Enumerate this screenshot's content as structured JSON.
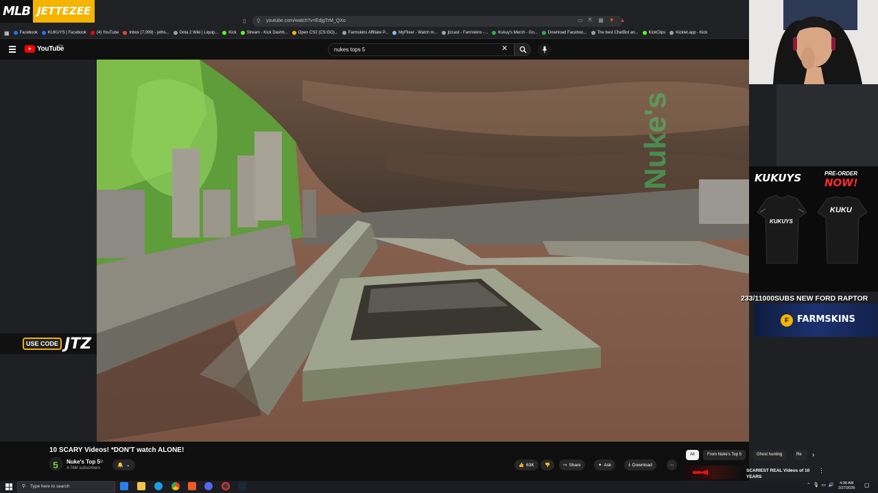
{
  "overlay": {
    "logo_mlb": "MLB",
    "logo_name": "JETTEZEE",
    "use_code_label": "USE CODE",
    "use_code_value": "JTZ",
    "subs_banner": "233/11000SUBS NEW FORD RAPTOR",
    "farmskins_label": "FARMSKINS",
    "merch_brand": "KUKUYS",
    "merch_preorder": "PRE-ORDER",
    "merch_now": "NOW!",
    "jersey_left_text": "KUKUYS",
    "jersey_right_text": "KUKU",
    "nuke_watermark": "Nuke's"
  },
  "browser": {
    "url": "youtube.com/watch?v=EdjgTrM_QXo",
    "bookmarks": [
      {
        "label": "Facebook",
        "color": "#1877f2"
      },
      {
        "label": "KUKUYS | Facebook",
        "color": "#1877f2"
      },
      {
        "label": "(4) YouTube",
        "color": "#ff0000"
      },
      {
        "label": "Inbox (7,099) - jeths...",
        "color": "#ea4335"
      },
      {
        "label": "Dota 2 Wiki | Liquip...",
        "color": "#9aa0a6"
      },
      {
        "label": "Kick",
        "color": "#53fc18"
      },
      {
        "label": "Stream - Kick Dashb...",
        "color": "#53fc18"
      },
      {
        "label": "Open CS2 (CS:GO)...",
        "color": "#f4b400"
      },
      {
        "label": "Farmskins Affiliate P...",
        "color": "#9aa0a6"
      },
      {
        "label": "MyFlixer - Watch m...",
        "color": "#8ab4f8"
      },
      {
        "label": "jtzcast - Farmskins -...",
        "color": "#9aa0a6"
      },
      {
        "label": "Kukuy's Merch - Go...",
        "color": "#34a853"
      },
      {
        "label": "Download Faceboo...",
        "color": "#34a853"
      },
      {
        "label": "The best ChatBot an...",
        "color": "#9aa0a6"
      },
      {
        "label": "KickClips",
        "color": "#53fc18"
      },
      {
        "label": "Kicklet.app - Kick",
        "color": "#9aa0a6"
      }
    ]
  },
  "youtube": {
    "wordmark": "YouTube",
    "country": "PH",
    "search_query": "nukes tops 5",
    "video": {
      "title": "10 SCARY Videos! *DON'T watch ALONE!",
      "channel_name": "Nuke's Top 5",
      "subscribers": "4.76M subscribers",
      "likes": "63K",
      "share_label": "Share",
      "ask_label": "Ask",
      "download_label": "Download"
    },
    "chips": [
      "All",
      "From Nuke's Top 5",
      "Ghost hunting",
      "Re"
    ],
    "recommended": {
      "title": "SCARIEST REAL Videos of 10 YEARS"
    }
  },
  "taskbar": {
    "search_placeholder": "Type here to search",
    "time": "4:38 AM",
    "date": "2/27/2026"
  }
}
